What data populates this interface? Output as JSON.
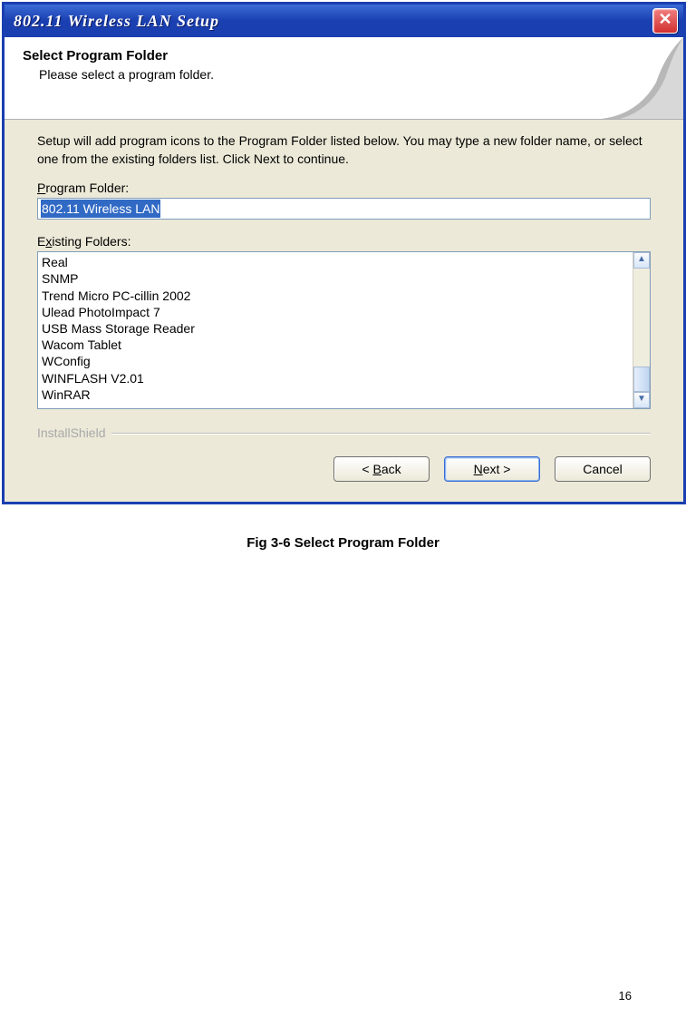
{
  "window": {
    "title": "802.11  Wireless LAN Setup"
  },
  "header": {
    "title": "Select Program Folder",
    "subtitle": "Please select a program folder."
  },
  "body": {
    "instruction": "Setup will add program icons to the Program Folder listed below.  You may type a new folder name, or select one from the existing folders list.  Click Next to continue.",
    "program_folder_label_pre": "P",
    "program_folder_label_post": "rogram Folder:",
    "program_folder_value": "802.11 Wireless LAN",
    "existing_label_pre": "E",
    "existing_label_mid": "x",
    "existing_label_post": "isting Folders:",
    "existing_folders": [
      "Real",
      "SNMP",
      "Trend Micro PC-cillin 2002",
      "Ulead PhotoImpact 7",
      "USB Mass Storage Reader",
      "Wacom Tablet",
      "WConfig",
      "WINFLASH V2.01",
      "WinRAR"
    ]
  },
  "footer": {
    "brand": "InstallShield",
    "back_pre": "< ",
    "back_ul": "B",
    "back_post": "ack",
    "next_ul": "N",
    "next_post": "ext >",
    "cancel": "Cancel"
  },
  "caption": "Fig 3-6 Select Program Folder",
  "page_number": "16"
}
